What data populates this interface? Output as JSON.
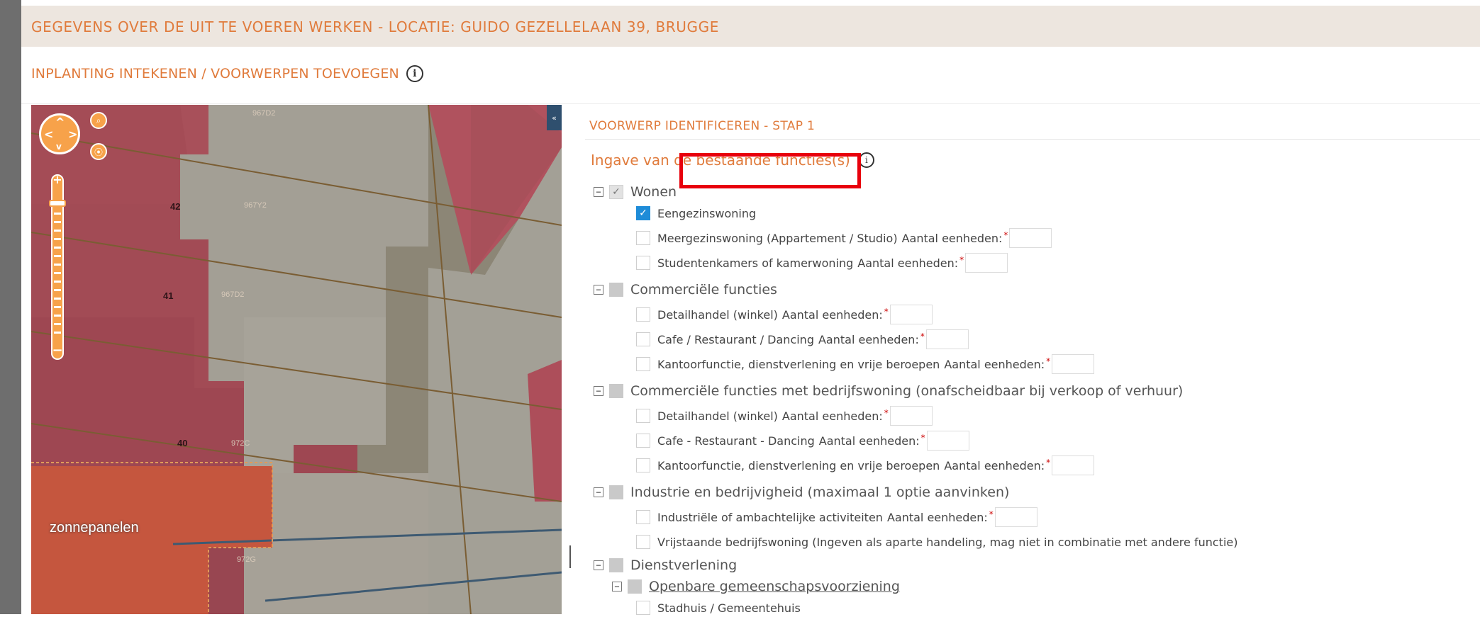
{
  "header": {
    "title": "GEGEVENS OVER DE UIT TE VOEREN WERKEN - LOCATIE: GUIDO GEZELLELAAN 39, BRUGGE"
  },
  "subheader": {
    "label": "INPLANTING INTEKENEN / VOORWERPEN TOEVOEGEN",
    "info_icon": "i"
  },
  "map": {
    "collapse_symbol": "«",
    "parcel_numbers": [
      "967D2",
      "42",
      "967Y2",
      "41",
      "967D2",
      "40",
      "972C",
      "972G"
    ],
    "overlay_label": "zonnepanelen",
    "nav_arrows": {
      "up": "^",
      "down": "v",
      "left": "<",
      "right": ">"
    },
    "search_icon": "⌕",
    "locate_icon": "⦿",
    "zoom_in": "+",
    "zoom_out": "−"
  },
  "form": {
    "step_title": "VOORWERP IDENTIFICEREN - STAP 1",
    "section_title": "Ingave van de bestaande functies(s)",
    "info_icon": "i",
    "expander_symbol": "−",
    "checkmark": "✓",
    "unit_label": "Aantal eenheden:",
    "required_marker": "*",
    "groups": [
      {
        "label": "Wonen",
        "items": [
          {
            "label": "Eengezinswoning",
            "checked": true,
            "has_count": false
          },
          {
            "label": "Meergezinswoning (Appartement / Studio)",
            "checked": false,
            "has_count": true
          },
          {
            "label": "Studentenkamers of kamerwoning",
            "checked": false,
            "has_count": true
          }
        ]
      },
      {
        "label": "Commerciële functies",
        "items": [
          {
            "label": "Detailhandel (winkel)",
            "checked": false,
            "has_count": true
          },
          {
            "label": "Cafe / Restaurant / Dancing",
            "checked": false,
            "has_count": true
          },
          {
            "label": "Kantoorfunctie, dienstverlening en vrije beroepen",
            "checked": false,
            "has_count": true
          }
        ]
      },
      {
        "label": "Commerciële functies met bedrijfswoning (onafscheidbaar bij verkoop of verhuur)",
        "items": [
          {
            "label": "Detailhandel (winkel)",
            "checked": false,
            "has_count": true
          },
          {
            "label": "Cafe - Restaurant - Dancing",
            "checked": false,
            "has_count": true
          },
          {
            "label": "Kantoorfunctie, dienstverlening en vrije beroepen",
            "checked": false,
            "has_count": true
          }
        ]
      },
      {
        "label": "Industrie en bedrijvigheid (maximaal 1 optie aanvinken)",
        "items": [
          {
            "label": "Industriële of ambachtelijke activiteiten",
            "checked": false,
            "has_count": true
          },
          {
            "label": "Vrijstaande bedrijfswoning (Ingeven als aparte handeling, mag niet in combinatie met andere functie)",
            "checked": false,
            "has_count": false
          }
        ]
      },
      {
        "label": "Dienstverlening",
        "subgroup": "Openbare gemeenschapsvoorziening",
        "cut_item": "Stadhuis / Gemeentehuis"
      }
    ]
  }
}
